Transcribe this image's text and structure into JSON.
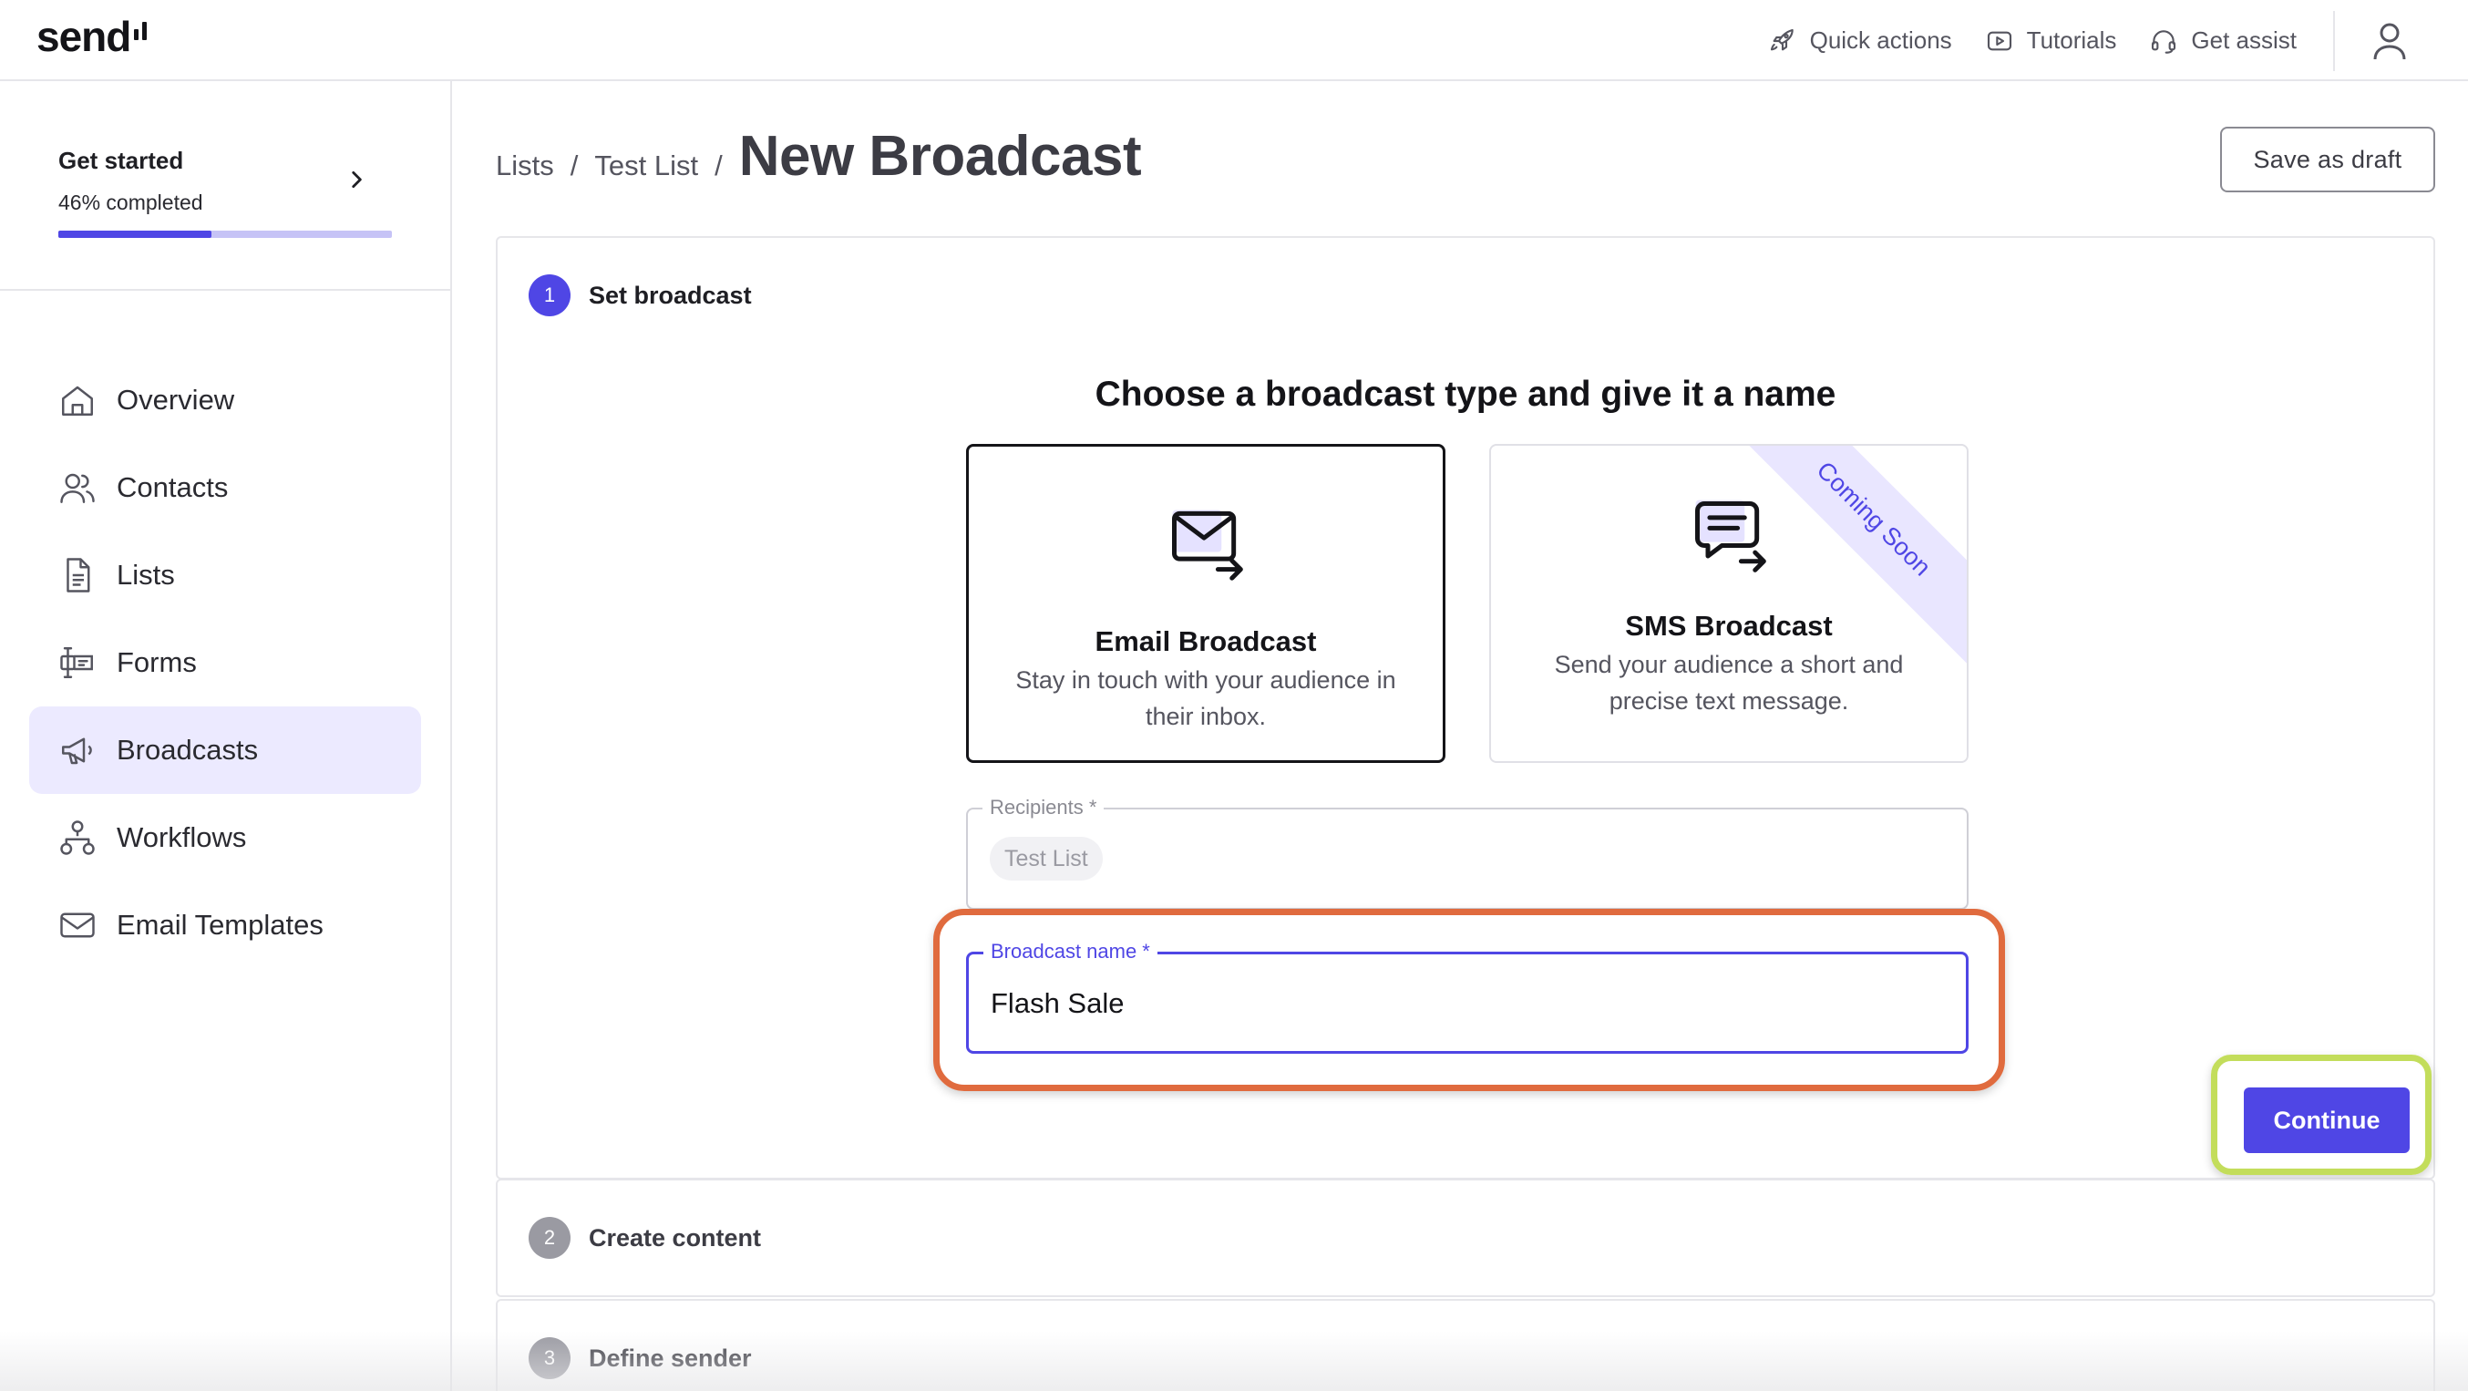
{
  "app": {
    "logo_text": "send",
    "accent_color": "#4f46e5",
    "highlight_colors": {
      "name_field": "#e06b3e",
      "continue_button": "#c3dd5b"
    }
  },
  "topbar": {
    "actions": [
      {
        "label": "Quick actions",
        "icon": "rocket-icon"
      },
      {
        "label": "Tutorials",
        "icon": "play-icon"
      },
      {
        "label": "Get assist",
        "icon": "headset-icon"
      }
    ],
    "user_icon": "user-icon"
  },
  "sidebar": {
    "get_started": {
      "title": "Get started",
      "progress_text": "46% completed",
      "progress_percent": 46
    },
    "items": [
      {
        "label": "Overview",
        "icon": "home-icon",
        "active": false
      },
      {
        "label": "Contacts",
        "icon": "contacts-icon",
        "active": false
      },
      {
        "label": "Lists",
        "icon": "document-icon",
        "active": false
      },
      {
        "label": "Forms",
        "icon": "form-icon",
        "active": false
      },
      {
        "label": "Broadcasts",
        "icon": "megaphone-icon",
        "active": true
      },
      {
        "label": "Workflows",
        "icon": "workflow-icon",
        "active": false
      },
      {
        "label": "Email Templates",
        "icon": "envelope-icon",
        "active": false
      }
    ]
  },
  "header": {
    "breadcrumb": [
      "Lists",
      "Test List"
    ],
    "separator": "/",
    "title": "New Broadcast",
    "save_draft_label": "Save as draft"
  },
  "steps": [
    {
      "number": "1",
      "label": "Set broadcast",
      "active": true
    },
    {
      "number": "2",
      "label": "Create content",
      "active": false
    },
    {
      "number": "3",
      "label": "Define sender",
      "active": false
    }
  ],
  "set_broadcast": {
    "heading": "Choose a broadcast type and give it a name",
    "types": [
      {
        "name": "Email Broadcast",
        "description": "Stay in touch with your audience in their inbox.",
        "icon": "email-send-icon",
        "selected": true
      },
      {
        "name": "SMS Broadcast",
        "description": "Send your audience a short and precise text message.",
        "icon": "sms-send-icon",
        "selected": false,
        "ribbon": "Coming Soon"
      }
    ],
    "recipients": {
      "label": "Recipients *",
      "chip": "Test List"
    },
    "broadcast_name": {
      "label": "Broadcast name *",
      "value": "Flash Sale"
    },
    "continue_label": "Continue"
  }
}
